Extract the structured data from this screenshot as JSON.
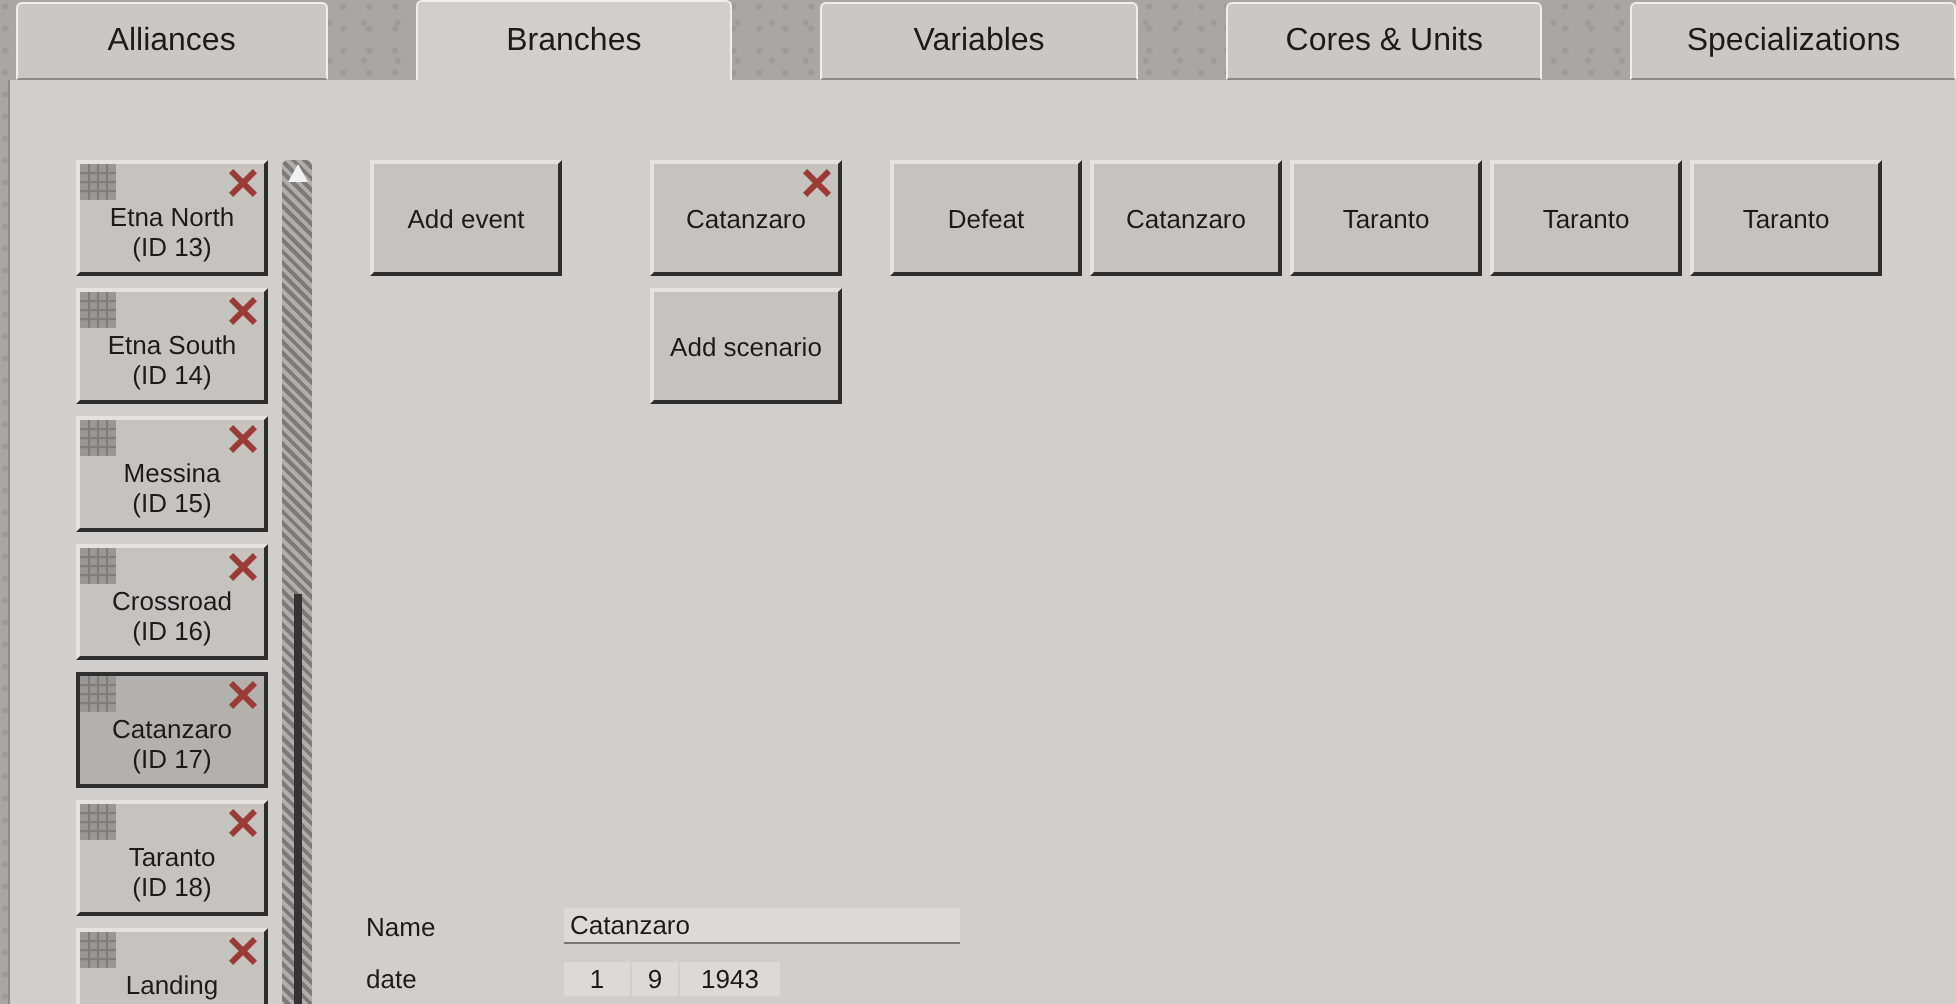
{
  "tabs": [
    {
      "label": "Alliances",
      "selected": false
    },
    {
      "label": "Branches",
      "selected": true
    },
    {
      "label": "Variables",
      "selected": false
    },
    {
      "label": "Cores & Units",
      "selected": false
    },
    {
      "label": "Specializations",
      "selected": false
    }
  ],
  "branches": [
    {
      "name": "Etna North",
      "id_label": "(ID 13)",
      "selected": false
    },
    {
      "name": "Etna South",
      "id_label": "(ID 14)",
      "selected": false
    },
    {
      "name": "Messina",
      "id_label": "(ID 15)",
      "selected": false
    },
    {
      "name": "Crossroad",
      "id_label": "(ID 16)",
      "selected": false
    },
    {
      "name": "Catanzaro",
      "id_label": "(ID 17)",
      "selected": true
    },
    {
      "name": "Taranto",
      "id_label": "(ID 18)",
      "selected": false
    },
    {
      "name": "Landing",
      "selected": false
    }
  ],
  "add_event_button": "Add event",
  "scenarios": [
    {
      "label": "Catanzaro",
      "deletable": true
    }
  ],
  "add_scenario_button": "Add scenario",
  "outcomes": [
    "Defeat",
    "Catanzaro",
    "Taranto",
    "Taranto",
    "Taranto"
  ],
  "form": {
    "name_label": "Name",
    "name_value": "Catanzaro",
    "date_label": "date",
    "date_parts": [
      "1",
      "9",
      "1943"
    ]
  }
}
